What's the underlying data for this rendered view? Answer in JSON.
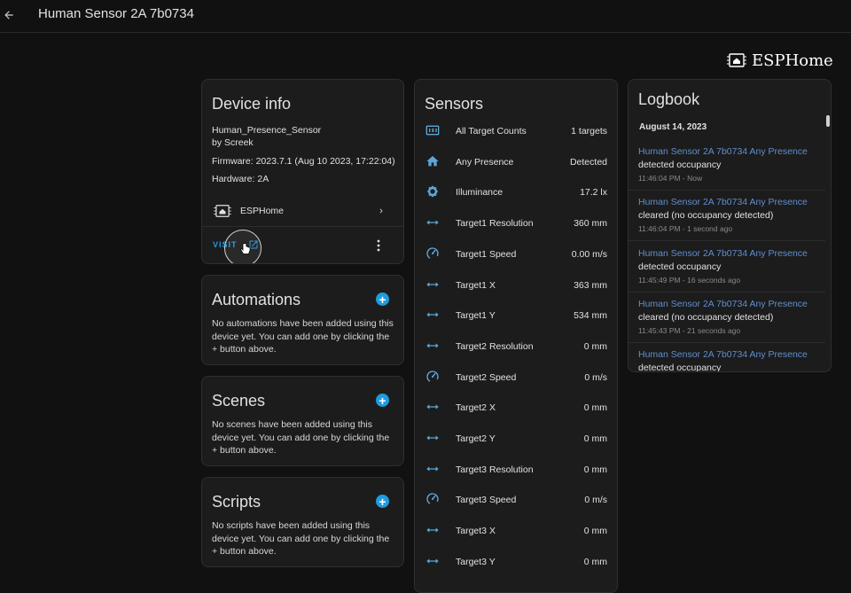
{
  "header": {
    "title": "Human Sensor 2A 7b0734",
    "back_icon": "arrow-left-icon"
  },
  "brand": {
    "text": "ESPHome",
    "icon": "esphome-chip-icon"
  },
  "device_info": {
    "title": "Device info",
    "model": "Human_Presence_Sensor",
    "manufacturer": "by Screek",
    "firmware": "Firmware: 2023.7.1 (Aug 10 2023, 17:22:04)",
    "hardware": "Hardware: 2A",
    "integration_label": "ESPHome",
    "visit_label": "VISIT"
  },
  "automations": {
    "title": "Automations",
    "desc": "No automations have been added using this device yet. You can add one by clicking the + button above."
  },
  "scenes": {
    "title": "Scenes",
    "desc": "No scenes have been added using this device yet. You can add one by clicking the + button above."
  },
  "scripts": {
    "title": "Scripts",
    "desc": "No scripts have been added using this device yet. You can add one by clicking the + button above."
  },
  "sensors": {
    "title": "Sensors",
    "items": [
      {
        "name": "All Target Counts",
        "value": "1 targets",
        "icon": "counter-icon"
      },
      {
        "name": "Any Presence",
        "value": "Detected",
        "icon": "home-icon"
      },
      {
        "name": "Illuminance",
        "value": "17.2 lx",
        "icon": "brightness-icon"
      },
      {
        "name": "Target1 Resolution",
        "value": "360 mm",
        "icon": "arrow-left-right-icon"
      },
      {
        "name": "Target1 Speed",
        "value": "0.00 m/s",
        "icon": "speedometer-icon"
      },
      {
        "name": "Target1 X",
        "value": "363 mm",
        "icon": "arrow-left-right-icon"
      },
      {
        "name": "Target1 Y",
        "value": "534 mm",
        "icon": "arrow-left-right-icon"
      },
      {
        "name": "Target2 Resolution",
        "value": "0 mm",
        "icon": "arrow-left-right-icon"
      },
      {
        "name": "Target2 Speed",
        "value": "0 m/s",
        "icon": "speedometer-icon"
      },
      {
        "name": "Target2 X",
        "value": "0 mm",
        "icon": "arrow-left-right-icon"
      },
      {
        "name": "Target2 Y",
        "value": "0 mm",
        "icon": "arrow-left-right-icon"
      },
      {
        "name": "Target3 Resolution",
        "value": "0 mm",
        "icon": "arrow-left-right-icon"
      },
      {
        "name": "Target3 Speed",
        "value": "0 m/s",
        "icon": "speedometer-icon"
      },
      {
        "name": "Target3 X",
        "value": "0 mm",
        "icon": "arrow-left-right-icon"
      },
      {
        "name": "Target3 Y",
        "value": "0 mm",
        "icon": "arrow-left-right-icon"
      }
    ]
  },
  "logbook": {
    "title": "Logbook",
    "date": "August 14, 2023",
    "entries": [
      {
        "entity": "Human Sensor 2A 7b0734 Any Presence",
        "message": "detected occupancy",
        "time": "11:46:04 PM - Now"
      },
      {
        "entity": "Human Sensor 2A 7b0734 Any Presence",
        "message": "cleared (no occupancy detected)",
        "time": "11:46:04 PM - 1 second ago"
      },
      {
        "entity": "Human Sensor 2A 7b0734 Any Presence",
        "message": "detected occupancy",
        "time": "11:45:49 PM - 16 seconds ago"
      },
      {
        "entity": "Human Sensor 2A 7b0734 Any Presence",
        "message": "cleared (no occupancy detected)",
        "time": "11:45:43 PM - 21 seconds ago"
      },
      {
        "entity": "Human Sensor 2A 7b0734 Any Presence",
        "message": "detected occupancy",
        "time": ""
      }
    ]
  },
  "colors": {
    "accent": "#1f9bde",
    "link": "#5f8fcf",
    "background": "#111111",
    "card": "#1c1c1c"
  }
}
